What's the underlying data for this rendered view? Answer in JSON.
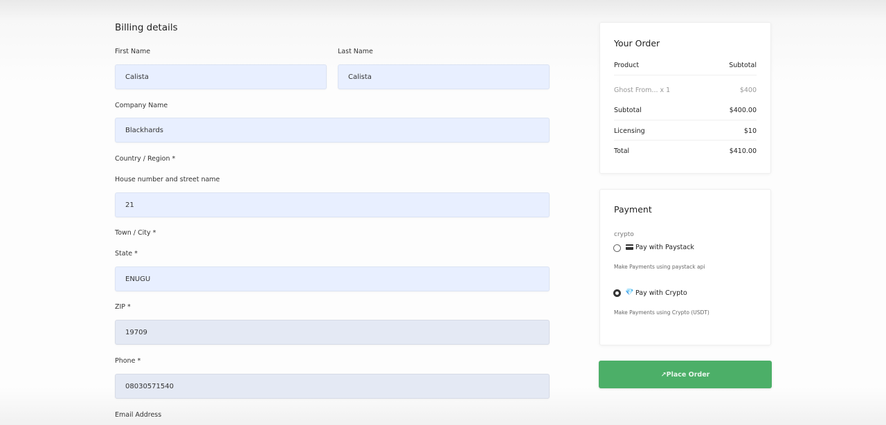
{
  "billing": {
    "title": "Billing details",
    "first_name": {
      "label": "First Name",
      "value": "Calista"
    },
    "last_name": {
      "label": "Last Name",
      "value": "Calista"
    },
    "company": {
      "label": "Company Name",
      "value": "Blackhards"
    },
    "country": {
      "label": "Country / Region *"
    },
    "house": {
      "label": "House number and street name",
      "value": "21"
    },
    "town": {
      "label": "Town / City *"
    },
    "state": {
      "label": "State *",
      "value": "ENUGU"
    },
    "zip": {
      "label": "ZIP *",
      "value": "19709"
    },
    "phone": {
      "label": "Phone *",
      "value": "08030571540"
    },
    "email": {
      "label": "Email Address"
    }
  },
  "order": {
    "title": "Your Order",
    "header": {
      "product": "Product",
      "subtotal": "Subtotal"
    },
    "item": {
      "name": "Ghost From... x 1",
      "price": "$400"
    },
    "subtotal": {
      "label": "Subtotal",
      "value": "$400.00"
    },
    "licensing": {
      "label": "Licensing",
      "value": "$10"
    },
    "total": {
      "label": "Total",
      "value": "$410.00"
    }
  },
  "payment": {
    "title": "Payment",
    "group_label": "crypto",
    "options": [
      {
        "label": "Pay with Paystack",
        "description": "Make Payments using paystack api",
        "selected": false,
        "icon": "card-icon"
      },
      {
        "label": "Pay with Crypto",
        "description": "Make Payments using Crypto (USDT)",
        "selected": true,
        "icon": "diamond-icon"
      }
    ]
  },
  "actions": {
    "place_order": "↗Place Order"
  },
  "colors": {
    "field_bg": "#e8efff",
    "button_green": "#4caf68"
  }
}
